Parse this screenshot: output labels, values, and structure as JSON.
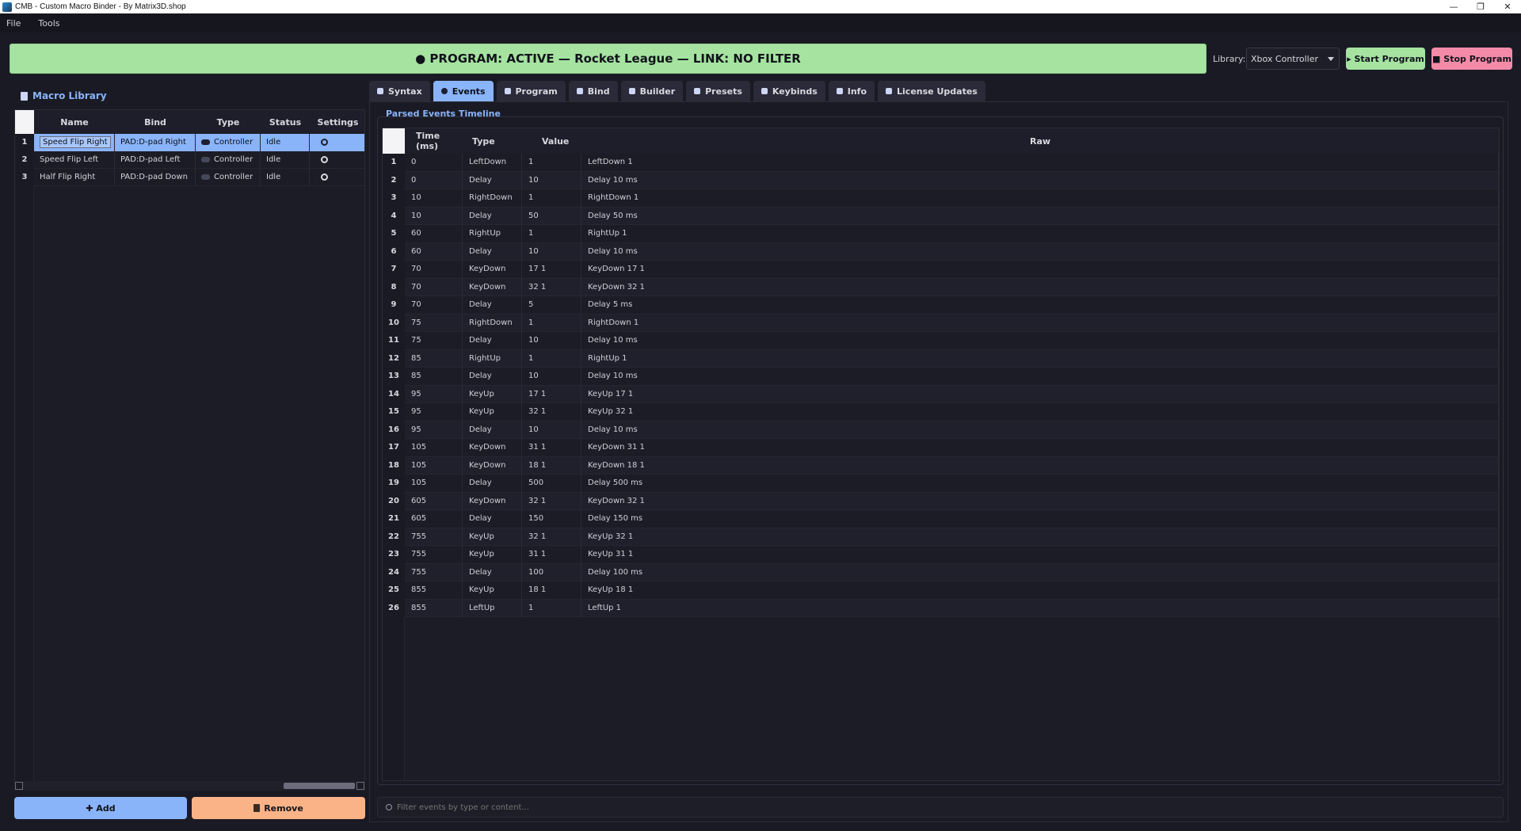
{
  "window": {
    "title": "CMB - Custom Macro Binder - By Matrix3D.shop",
    "controls": [
      "—",
      "❐",
      "✕"
    ]
  },
  "menu": [
    "File",
    "Tools"
  ],
  "banner": {
    "text": "● PROGRAM: ACTIVE — Rocket League — LINK: NO FILTER",
    "color": "#a6e3a1"
  },
  "library": {
    "label": "Library:",
    "selected": "Xbox Controller"
  },
  "buttons": {
    "start": "▸ Start Program",
    "stop": "■ Stop Program",
    "add": "✚ Add",
    "remove": "Remove"
  },
  "macro_library": {
    "title": "Macro Library",
    "columns": [
      "Name",
      "Bind",
      "Type",
      "Status",
      "Settings"
    ],
    "rows": [
      {
        "num": "1",
        "name": "Speed Flip Right",
        "bind": "PAD:D-pad Right",
        "type": "Controller",
        "status": "Idle"
      },
      {
        "num": "2",
        "name": "Speed Flip Left",
        "bind": "PAD:D-pad Left",
        "type": "Controller",
        "status": "Idle"
      },
      {
        "num": "3",
        "name": "Half Flip Right",
        "bind": "PAD:D-pad Down",
        "type": "Controller",
        "status": "Idle"
      }
    ]
  },
  "tabs": [
    "Syntax",
    "Events",
    "Program",
    "Bind",
    "Builder",
    "Presets",
    "Keybinds",
    "Info",
    "License  Updates"
  ],
  "active_tab": "Events",
  "events": {
    "group_title": "Parsed Events Timeline",
    "columns": [
      "Time (ms)",
      "Type",
      "Value",
      "Raw"
    ],
    "rows": [
      [
        "1",
        "0",
        "LeftDown",
        "1",
        "LeftDown 1"
      ],
      [
        "2",
        "0",
        "Delay",
        "10",
        "Delay 10 ms"
      ],
      [
        "3",
        "10",
        "RightDown",
        "1",
        "RightDown 1"
      ],
      [
        "4",
        "10",
        "Delay",
        "50",
        "Delay 50 ms"
      ],
      [
        "5",
        "60",
        "RightUp",
        "1",
        "RightUp 1"
      ],
      [
        "6",
        "60",
        "Delay",
        "10",
        "Delay 10 ms"
      ],
      [
        "7",
        "70",
        "KeyDown",
        "17 1",
        "KeyDown 17 1"
      ],
      [
        "8",
        "70",
        "KeyDown",
        "32 1",
        "KeyDown 32 1"
      ],
      [
        "9",
        "70",
        "Delay",
        "5",
        "Delay 5 ms"
      ],
      [
        "10",
        "75",
        "RightDown",
        "1",
        "RightDown 1"
      ],
      [
        "11",
        "75",
        "Delay",
        "10",
        "Delay 10 ms"
      ],
      [
        "12",
        "85",
        "RightUp",
        "1",
        "RightUp 1"
      ],
      [
        "13",
        "85",
        "Delay",
        "10",
        "Delay 10 ms"
      ],
      [
        "14",
        "95",
        "KeyUp",
        "17 1",
        "KeyUp 17 1"
      ],
      [
        "15",
        "95",
        "KeyUp",
        "32 1",
        "KeyUp 32 1"
      ],
      [
        "16",
        "95",
        "Delay",
        "10",
        "Delay 10 ms"
      ],
      [
        "17",
        "105",
        "KeyDown",
        "31 1",
        "KeyDown 31 1"
      ],
      [
        "18",
        "105",
        "KeyDown",
        "18 1",
        "KeyDown 18 1"
      ],
      [
        "19",
        "105",
        "Delay",
        "500",
        "Delay 500 ms"
      ],
      [
        "20",
        "605",
        "KeyDown",
        "32 1",
        "KeyDown 32 1"
      ],
      [
        "21",
        "605",
        "Delay",
        "150",
        "Delay 150 ms"
      ],
      [
        "22",
        "755",
        "KeyUp",
        "32 1",
        "KeyUp 32 1"
      ],
      [
        "23",
        "755",
        "KeyUp",
        "31 1",
        "KeyUp 31 1"
      ],
      [
        "24",
        "755",
        "Delay",
        "100",
        "Delay 100 ms"
      ],
      [
        "25",
        "855",
        "KeyUp",
        "18 1",
        "KeyUp 18 1"
      ],
      [
        "26",
        "855",
        "LeftUp",
        "1",
        "LeftUp 1"
      ]
    ]
  },
  "filter": {
    "placeholder": "Filter events by type or content..."
  },
  "colors": {
    "accent": "#89b4fa",
    "start": "#a6e3a1",
    "stop": "#f38ba8",
    "remove": "#fab387",
    "background": "#1a1a24"
  }
}
